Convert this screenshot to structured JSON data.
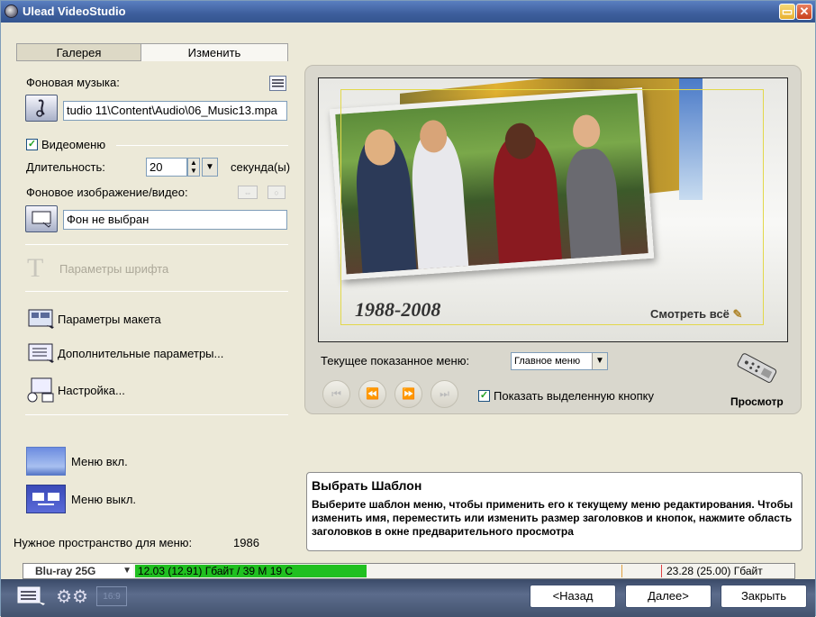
{
  "window": {
    "title": "Ulead VideoStudio"
  },
  "tabs": [
    {
      "label": "Галерея"
    },
    {
      "label": "Изменить"
    }
  ],
  "left": {
    "bg_music_label": "Фоновая музыка:",
    "bg_music_value": "tudio 11\\Content\\Audio\\06_Music13.mpa",
    "videomenu_label": "Видеоменю",
    "videomenu_checked": true,
    "duration_label": "Длительность:",
    "duration_value": "20",
    "duration_unit": "секунда(ы)",
    "bg_image_label": "Фоновое изображение/видео:",
    "bg_image_value": "Фон не выбран",
    "font_params": "Параметры шрифта",
    "layout_params": "Параметры макета",
    "extra_params": "Дополнительные параметры...",
    "setup": "Настройка...",
    "menu_on": "Меню вкл.",
    "menu_off": "Меню выкл.",
    "space_label": "Нужное пространство для меню:",
    "space_value": "1986"
  },
  "preview": {
    "year_text": "1988-2008",
    "see_all": "Смотреть всё",
    "current_menu_label": "Текущее показанное меню:",
    "current_menu_value": "Главное меню",
    "show_selected_label": "Показать выделенную кнопку",
    "show_selected_checked": true,
    "preview_label": "Просмотр"
  },
  "info": {
    "title": "Выбрать Шаблон",
    "body": "Выберите шаблон меню, чтобы применить его к текущему меню редактирования. Чтобы изменить имя, переместить или изменить размер заголовков и кнопок, нажмите область заголовков в окне предварительного просмотра"
  },
  "status": {
    "disc_type": "Blu-ray 25G",
    "used": "12.03 (12.91) Гбайт / 39 M 19 C",
    "capacity": "23.28 (25.00) Гбайт",
    "used_fraction": 0.35
  },
  "buttons": {
    "back": "<Назад",
    "next": "Далее>",
    "close": "Закрыть"
  },
  "colors": {
    "progress": "#20c020",
    "accent": "#3d5e9c"
  }
}
